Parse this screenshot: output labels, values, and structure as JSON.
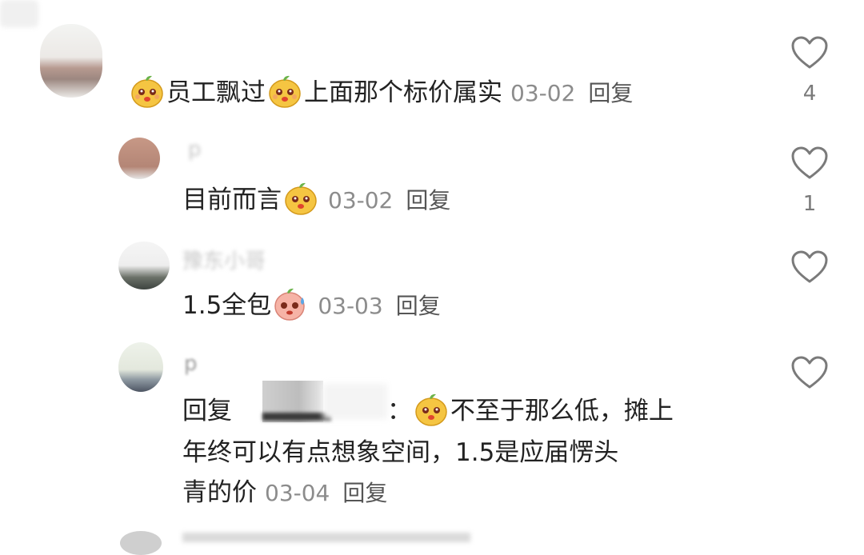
{
  "comments": [
    {
      "text_parts": [
        "员工飘过",
        "上面那个标价属实"
      ],
      "date": "03-02",
      "reply_label": "回复",
      "likes": "4"
    },
    {
      "username": "p",
      "text_parts": [
        "目前而言"
      ],
      "date": "03-02",
      "reply_label": "回复",
      "likes": "1"
    },
    {
      "username": "豫东小哥",
      "text_parts": [
        "1.5全包"
      ],
      "date": "03-03",
      "reply_label": "回复",
      "likes": ""
    },
    {
      "username": "p",
      "reply_prefix": "回复",
      "colon": "：",
      "text_line1": "不至于那么低，摊上",
      "text_line2": "年终可以有点想象空间，1.5是应届愣头",
      "text_line3": "青的价",
      "date": "03-04",
      "reply_label": "回复",
      "likes": ""
    }
  ],
  "icons": {
    "like": "heart-outline-icon",
    "emoji_smile": "smiling-face-emoji-icon",
    "emoji_sweat": "sweating-face-emoji-icon"
  },
  "colors": {
    "text": "#222222",
    "meta": "#8c8c8c",
    "icon": "#7a7a7a"
  }
}
